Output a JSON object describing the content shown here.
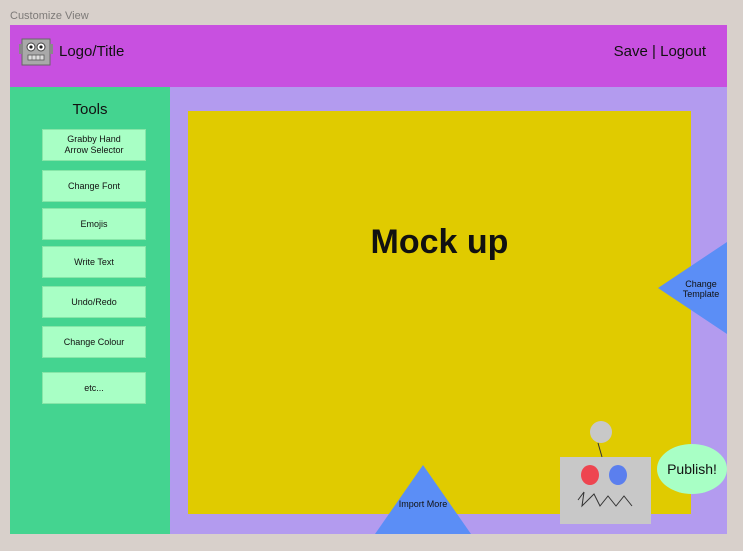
{
  "frame": {
    "title": "Customize View"
  },
  "header": {
    "logo_title": "Logo/Title",
    "save_label": "Save",
    "separator": " | ",
    "logout_label": "Logout",
    "logo_icon": "robot-face-icon",
    "bg_color": "#c850e0"
  },
  "sidebar": {
    "title": "Tools",
    "bg_color": "#44d490",
    "tools": [
      {
        "label": "Grabby Hand\nArrow Selector"
      },
      {
        "label": "Change Font"
      },
      {
        "label": "Emojis"
      },
      {
        "label": "Write Text"
      },
      {
        "label": "Undo/Redo"
      },
      {
        "label": "Change Colour"
      },
      {
        "label": "etc..."
      }
    ]
  },
  "canvas": {
    "label": "Mock up",
    "bg_color": "#e0cb00"
  },
  "actions": {
    "change_template": "Change Template",
    "import_more": "Import More",
    "publish": "Publish!",
    "assistant_icon": "robot-assistant-icon"
  },
  "colors": {
    "frame_bg": "#b39bef",
    "triangle_blue": "#5b8ef6",
    "button_green": "#a8ffc5"
  }
}
